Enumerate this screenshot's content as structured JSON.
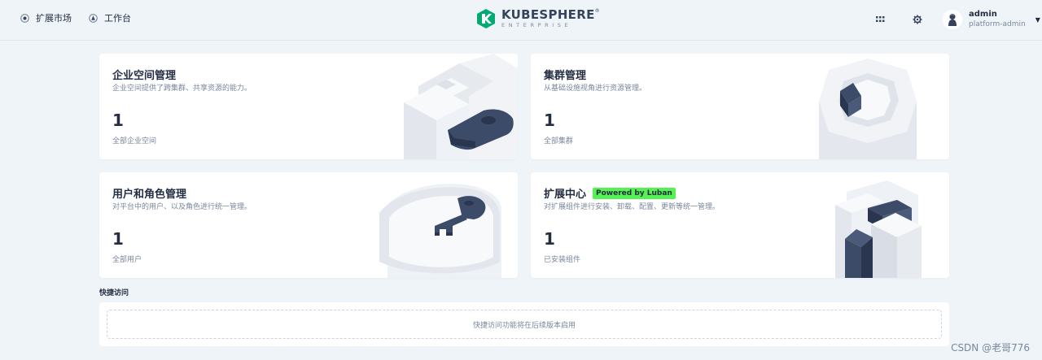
{
  "header": {
    "nav": [
      {
        "label": "扩展市场",
        "icon": "marketplace-icon"
      },
      {
        "label": "工作台",
        "icon": "workbench-icon"
      }
    ],
    "logo": {
      "main": "KUBESPHERE",
      "mark": "®",
      "sub": "ENTERPRISE"
    },
    "apps_icon": "grid-dots-icon",
    "settings_icon": "gear-icon",
    "user": {
      "name": "admin",
      "role": "platform-admin"
    }
  },
  "cards": {
    "workspaces": {
      "title": "企业空间管理",
      "desc": "企业空间提供了跨集群、共享资源的能力。",
      "count": "1",
      "count_label": "全部企业空间"
    },
    "clusters": {
      "title": "集群管理",
      "desc": "从基础设施视角进行资源管理。",
      "count": "1",
      "count_label": "全部集群"
    },
    "users": {
      "title": "用户和角色管理",
      "desc": "对平台中的用户、以及角色进行统一管理。",
      "count": "1",
      "count_label": "全部用户"
    },
    "extensions": {
      "title": "扩展中心",
      "badge": "Powered by Luban",
      "desc": "对扩展组件进行安装、卸载、配置、更新等统一管理。",
      "count": "1",
      "count_label": "已安装组件"
    }
  },
  "quick_access": {
    "label": "快捷访问",
    "placeholder": "快捷访问功能将在后续版本启用"
  },
  "watermark": "CSDN @老哥776",
  "colors": {
    "background": "#eff4f9",
    "dark": "#242e42",
    "muted": "#79879c",
    "badge": "#55f155",
    "art": "#3c4b68",
    "logo_green": "#00aa72"
  }
}
